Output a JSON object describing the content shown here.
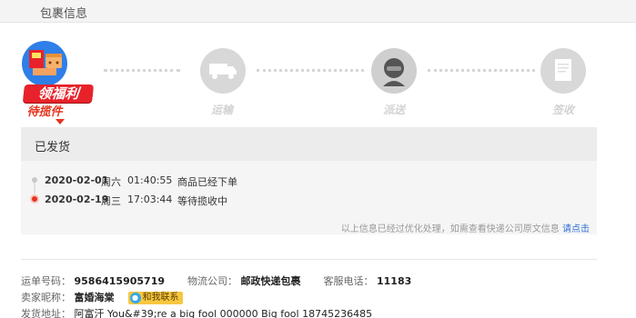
{
  "header": {
    "title": "包裹信息"
  },
  "steps": [
    {
      "label": "待揽件",
      "icon": "gift-package-icon",
      "active": true
    },
    {
      "label": "运输",
      "icon": "truck-icon",
      "active": false
    },
    {
      "label": "派送",
      "icon": "courier-icon",
      "active": false
    },
    {
      "label": "签收",
      "icon": "receipt-icon",
      "active": false
    }
  ],
  "promo": {
    "text": "领福利"
  },
  "panel": {
    "title": "已发货",
    "tracks": [
      {
        "date": "2020-02-01",
        "week": "周六",
        "time": "01:40:55",
        "status": "商品已经下单"
      },
      {
        "date": "2020-02-19",
        "week": "周三",
        "time": "17:03:44",
        "status": "等待揽收中"
      }
    ],
    "footer_note": "以上信息已经过优化处理，如需查看快递公司原文信息",
    "footer_link": "请点击"
  },
  "info": {
    "tracking_label": "运单号码：",
    "tracking_value": "9586415905719",
    "company_label": "物流公司：",
    "company_value": "邮政快递包裹",
    "phone_label": "客服电话：",
    "phone_value": "11183",
    "seller_label": "卖家昵称：",
    "seller_value": "富婚海棠",
    "contact_label": "和我联系",
    "address_label": "发货地址：",
    "address_value": "阿富汗 You&#39;re a big fool 000000   Big fool   18745236485"
  },
  "colors": {
    "accent_red": "#e5331e",
    "link_blue": "#2f6fd8",
    "active_blue": "#2f7fe8"
  }
}
